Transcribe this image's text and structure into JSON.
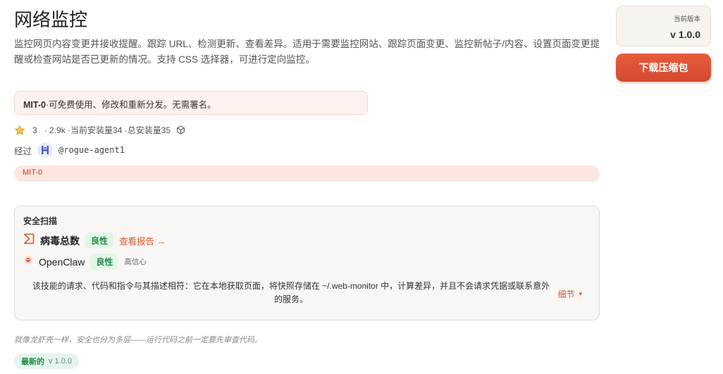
{
  "page": {
    "title": "网络监控",
    "description": "监控网页内容变更并接收提醒。跟踪 URL、检测更新、查看差异。适用于需要监控网站、跟踪页面变更、监控新帖子/内容、设置页面变更提醒或检查网站是否已更新的情况。支持 CSS 选择器，可进行定向监控。"
  },
  "license_box": {
    "name": "MIT-0",
    "text": "·可免费使用、修改和重新分发。无需署名。"
  },
  "stats": {
    "stars": "3",
    "text": "· 2.9k ·当前安装量34 ·总安装量35"
  },
  "author": {
    "prefix": "经过",
    "handle": "@rogue-agent1"
  },
  "license_tag": "MIT-0",
  "security_scan": {
    "title": "安全扫描",
    "virustotal": {
      "name": "病毒总数",
      "verdict": "良性",
      "report_link": "查看报告 →"
    },
    "openclaw": {
      "name": "OpenClaw",
      "verdict": "良性",
      "confidence": "高信心"
    },
    "summary": "该技能的请求、代码和指令与其描述相符：它在本地获取页面，将快照存储在 ~/.web-monitor 中，计算差异，并且不会请求凭据或联系意外的服务。",
    "details_label": "细节",
    "details_caret": "▾"
  },
  "footnote": "就像龙虾壳一样，安全也分为多层——运行代码之前一定要先审查代码。",
  "latest": {
    "label": "最新的",
    "version": "v 1.0.0"
  },
  "sidebar": {
    "version_label": "当前版本",
    "version_value": "v 1.0.0",
    "download_label": "下载压缩包"
  },
  "colors": {
    "accent": "#d9572c",
    "benign": "#1f8a45",
    "license_text": "#c0392b"
  }
}
